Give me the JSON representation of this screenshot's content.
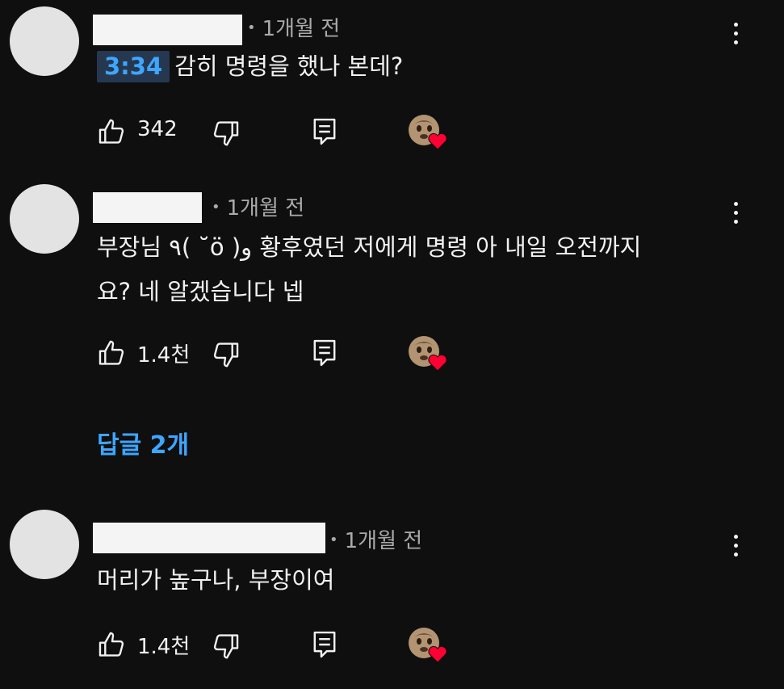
{
  "comments": [
    {
      "time_ago": "1개월 전",
      "timestamp_chip": "3:34",
      "text_lines": [
        "감히 명령을 했나 본데?"
      ],
      "likes": "342",
      "name_redacted": true
    },
    {
      "time_ago": "1개월 전",
      "text_lines": [
        "부장님 ٩( ˘̆ö )و 황후였던 저에게 명령 아 내일 오전까지",
        "요? 네 알겠습니다 넵"
      ],
      "likes": "1.4천",
      "replies_label": "답글 2개",
      "name_redacted": true
    },
    {
      "time_ago": "1개월 전",
      "text_lines": [
        "머리가 높구나, 부장이여"
      ],
      "likes": "1.4천",
      "name_redacted": true
    }
  ],
  "icons": {
    "like": "thumbs-up-icon",
    "dislike": "thumbs-down-icon",
    "reply": "reply-icon",
    "creator_heart": "creator-heart-icon",
    "more": "more-vert-icon"
  },
  "colors": {
    "background": "#0f0f0f",
    "text": "#f1f1f1",
    "meta": "#aaaaaa",
    "link": "#3ea6ff",
    "timestamp_bg": "#263850",
    "heart": "#ff0033"
  }
}
